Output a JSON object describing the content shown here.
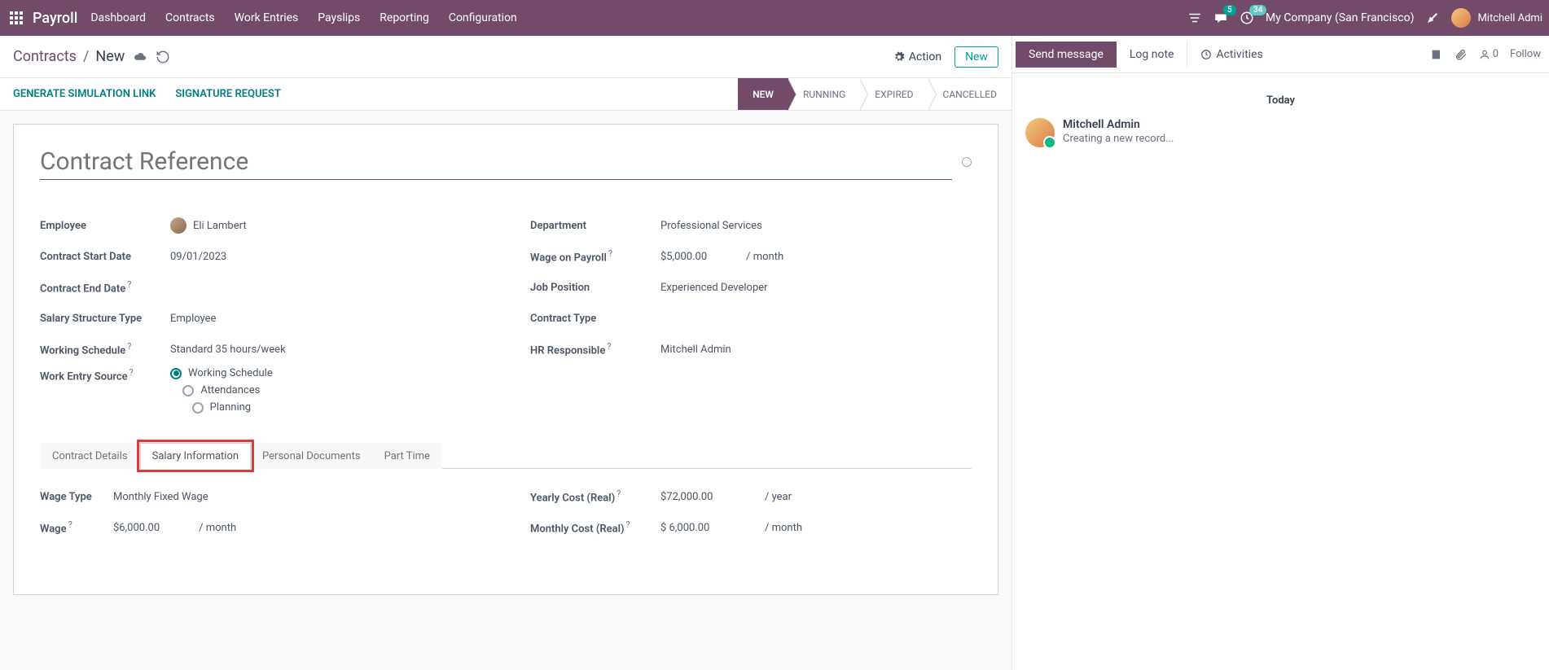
{
  "topnav": {
    "brand": "Payroll",
    "menu": [
      "Dashboard",
      "Contracts",
      "Work Entries",
      "Payslips",
      "Reporting",
      "Configuration"
    ],
    "messages_badge": "5",
    "activities_badge": "34",
    "company": "My Company (San Francisco)",
    "user": "Mitchell Admi"
  },
  "breadcrumb": {
    "parent": "Contracts",
    "current": "New"
  },
  "subheader": {
    "action": "Action",
    "new": "New"
  },
  "actionbar": {
    "gen_link": "GENERATE SIMULATION LINK",
    "sig_req": "SIGNATURE REQUEST",
    "statuses": [
      "NEW",
      "RUNNING",
      "EXPIRED",
      "CANCELLED"
    ]
  },
  "form": {
    "title_placeholder": "Contract Reference",
    "labels": {
      "employee": "Employee",
      "start": "Contract Start Date",
      "end": "Contract End Date",
      "struct": "Salary Structure Type",
      "schedule": "Working Schedule",
      "source": "Work Entry Source",
      "dept": "Department",
      "wage_payroll": "Wage on Payroll",
      "job": "Job Position",
      "ctype": "Contract Type",
      "hr": "HR Responsible"
    },
    "values": {
      "employee": "Eli Lambert",
      "start": "09/01/2023",
      "end": "",
      "struct": "Employee",
      "schedule": "Standard 35 hours/week",
      "dept": "Professional Services",
      "wage_payroll": "$5,000.00",
      "wage_unit": "/ month",
      "job": "Experienced Developer",
      "hr": "Mitchell Admin"
    },
    "radio": {
      "opt1": "Working Schedule",
      "opt2": "Attendances",
      "opt3": "Planning"
    }
  },
  "tabs": {
    "t1": "Contract Details",
    "t2": "Salary Information",
    "t3": "Personal Documents",
    "t4": "Part Time"
  },
  "salary": {
    "labels": {
      "wage_type": "Wage Type",
      "wage": "Wage",
      "yearly": "Yearly Cost (Real)",
      "monthly": "Monthly Cost (Real)"
    },
    "values": {
      "wage_type": "Monthly Fixed Wage",
      "wage": "$6,000.00",
      "wage_unit": "/ month",
      "yearly": "$72,000.00",
      "yearly_unit": "/ year",
      "monthly": "$ 6,000.00",
      "monthly_unit": "/ month"
    }
  },
  "chatter": {
    "send": "Send message",
    "log": "Log note",
    "activities": "Activities",
    "followers": "0",
    "follow": "Follow",
    "today": "Today",
    "msg_author": "Mitchell Admin",
    "msg_text": "Creating a new record..."
  }
}
